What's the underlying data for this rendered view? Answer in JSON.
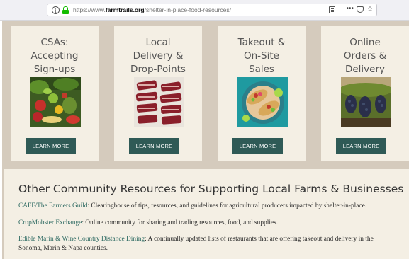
{
  "browser": {
    "url_prefix": "https://www.",
    "url_domain": "farmtrails.org",
    "url_path": "/shelter-in-place-food-resources/",
    "info_glyph": "i",
    "more_glyph": "•••",
    "star_glyph": "☆"
  },
  "cards": [
    {
      "title": "CSAs:\nAccepting\nSign-ups",
      "image": "vegetable-basket-photo",
      "button": "LEARN MORE"
    },
    {
      "title": "Local\nDelivery &\nDrop-Points",
      "image": "meat-cuts-photo",
      "button": "LEARN MORE"
    },
    {
      "title": "Takeout &\nOn-Site\nSales",
      "image": "tacos-plate-photo",
      "button": "LEARN MORE"
    },
    {
      "title": "Online\nOrders &\nDelivery",
      "image": "grape-vineyard-photo",
      "button": "LEARN MORE"
    }
  ],
  "resources": {
    "heading": "Other Community Resources for Supporting Local Farms & Businesses",
    "items": [
      {
        "link": "CAFF/The Farmers Guild",
        "text": ": Clearinghouse of tips, resources, and guidelines for agricultural producers impacted by shelter-in-place."
      },
      {
        "link": "CropMobster Exchange",
        "text": ": Online community for sharing and trading resources, food, and supplies."
      },
      {
        "link": "Edible Marin & Wine Country Distance Dining",
        "text": ": A continually updated lists of restaurants that are offering takeout and delivery in the Sonoma, Marin & Napa counties."
      }
    ]
  },
  "colors": {
    "page_bg": "#d5cbbd",
    "card_bg": "#f4efe4",
    "button_bg": "#2f5a56",
    "link": "#2f6b63"
  }
}
